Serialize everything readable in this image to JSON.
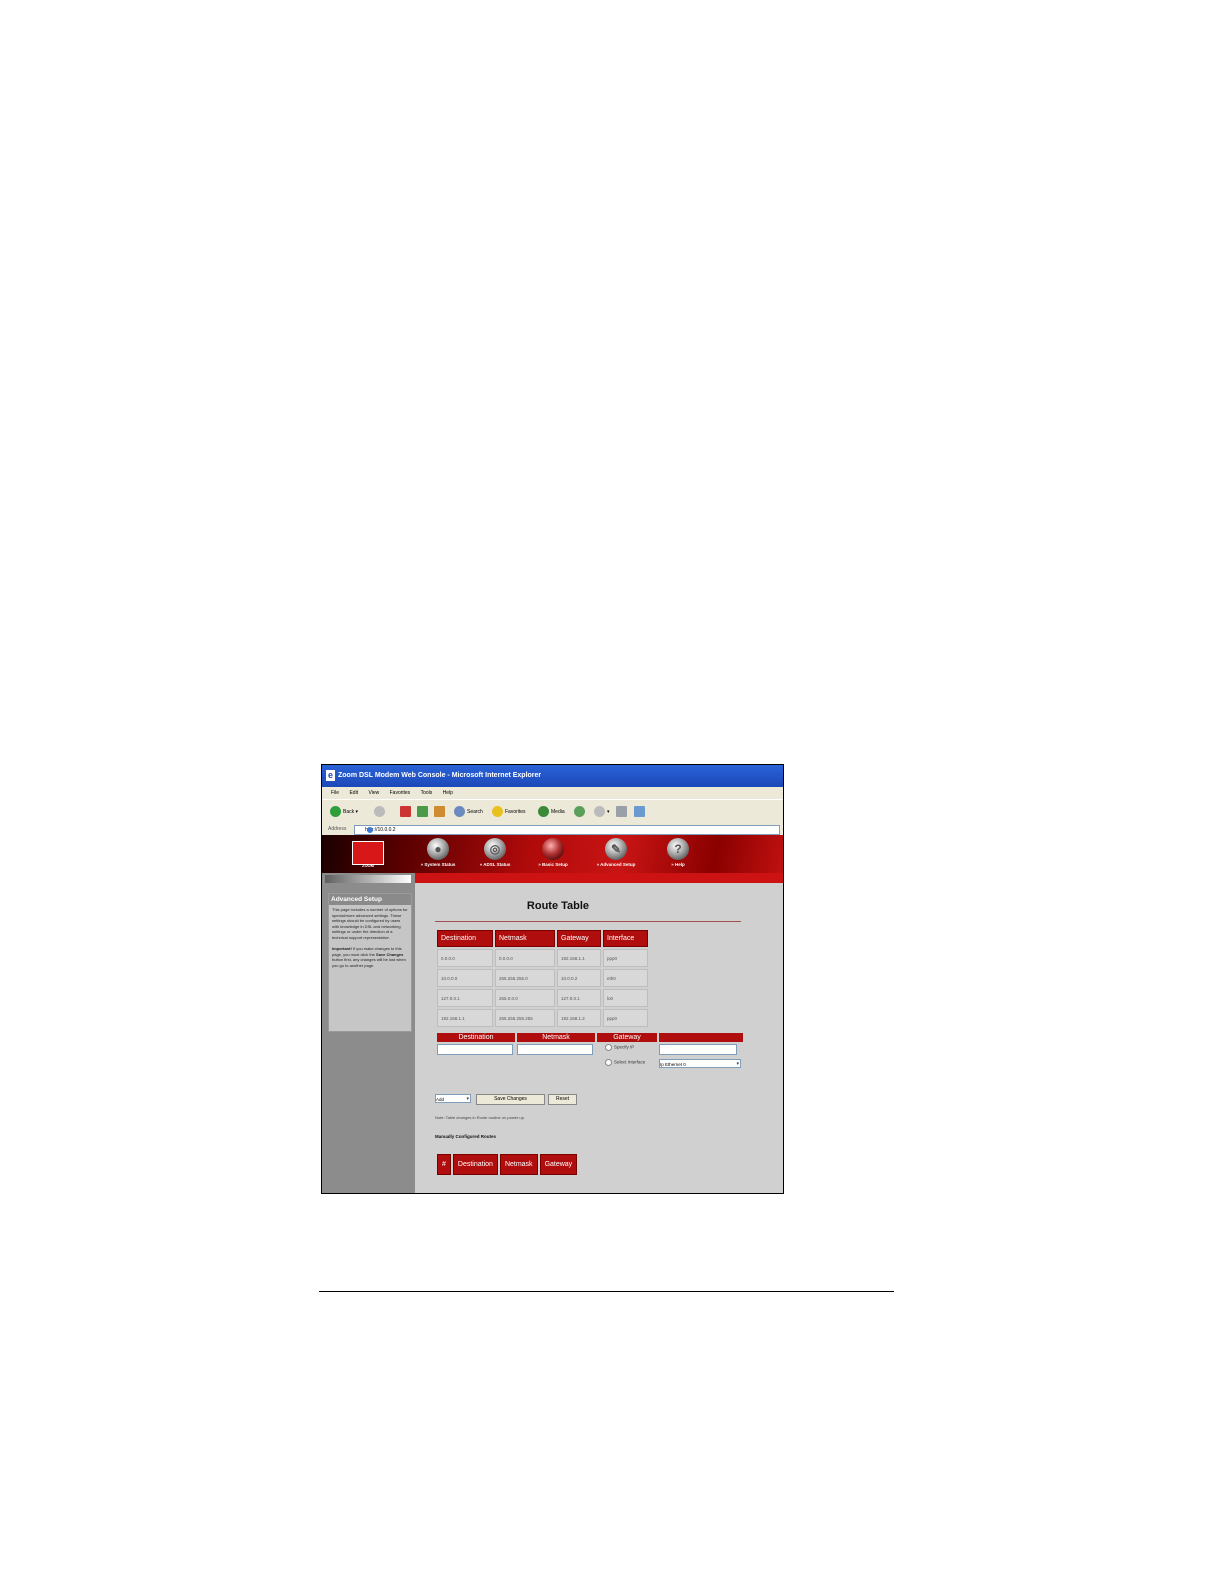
{
  "browser": {
    "title": "Zoom DSL Modem Web Console - Microsoft Internet Explorer",
    "menu": [
      "File",
      "Edit",
      "View",
      "Favorites",
      "Tools",
      "Help"
    ],
    "toolbar": {
      "back": "Back",
      "search": "Search",
      "favorites": "Favorites",
      "media": "Media"
    },
    "address_label": "Address",
    "address": "http://10.0.0.2"
  },
  "banner": {
    "logo_text": "ZOOM",
    "nav": [
      {
        "label": "» System Status",
        "icon": "status-icon"
      },
      {
        "label": "» ADSL Status",
        "icon": "adsl-icon"
      },
      {
        "label": "» Basic Setup",
        "icon": "basic-setup-icon"
      },
      {
        "label": "» Advanced Setup",
        "icon": "wrench-icon"
      },
      {
        "label": "» Help",
        "icon": "help-icon"
      }
    ]
  },
  "sidebar": {
    "heading": "Advanced Setup",
    "body": "This page includes a number of options for special/more advanced settings. These settings should be configured by users with knowledge in DSL and networking settings or under the direction of a technical support representative.",
    "important_label": "Important!",
    "important_pre": " If you make changes to this page, you must click the ",
    "important_button": "Save Changes",
    "important_post": " button first, any changes will be lost when you go to another page."
  },
  "main": {
    "title": "Route Table",
    "route_table": {
      "headers": [
        "Destination",
        "Netmask",
        "Gateway",
        "Interface"
      ],
      "rows": [
        [
          "0.0.0.0",
          "0.0.0.0",
          "192.168.1.1",
          "ppp0"
        ],
        [
          "10.0.0.0",
          "255.255.255.0",
          "10.0.0.2",
          "eth0"
        ],
        [
          "127.0.0.1",
          "255.0.0.0",
          "127.0.0.1",
          "lo0"
        ],
        [
          "192.168.1.1",
          "255.255.255.255",
          "192.168.1.2",
          "ppp0"
        ]
      ]
    },
    "form": {
      "headers": [
        "Destination",
        "Netmask",
        "Gateway"
      ],
      "specify_ip": "Specify IP",
      "select_interface": "Select Interface",
      "interface_value": "Ip Ethernet 0"
    },
    "mode_value": "Add",
    "save_label": "Save Changes",
    "reset_label": "Reset",
    "note": "Note: Table changes in Route routine on power up.",
    "manual_heading": "Manually Configured Routes",
    "manual_headers": [
      "#",
      "Destination",
      "Netmask",
      "Gateway"
    ]
  },
  "colors": {
    "accent": "#b00e0e",
    "titlebar": "#2a63d8",
    "content_bg": "#d0d0d0"
  }
}
